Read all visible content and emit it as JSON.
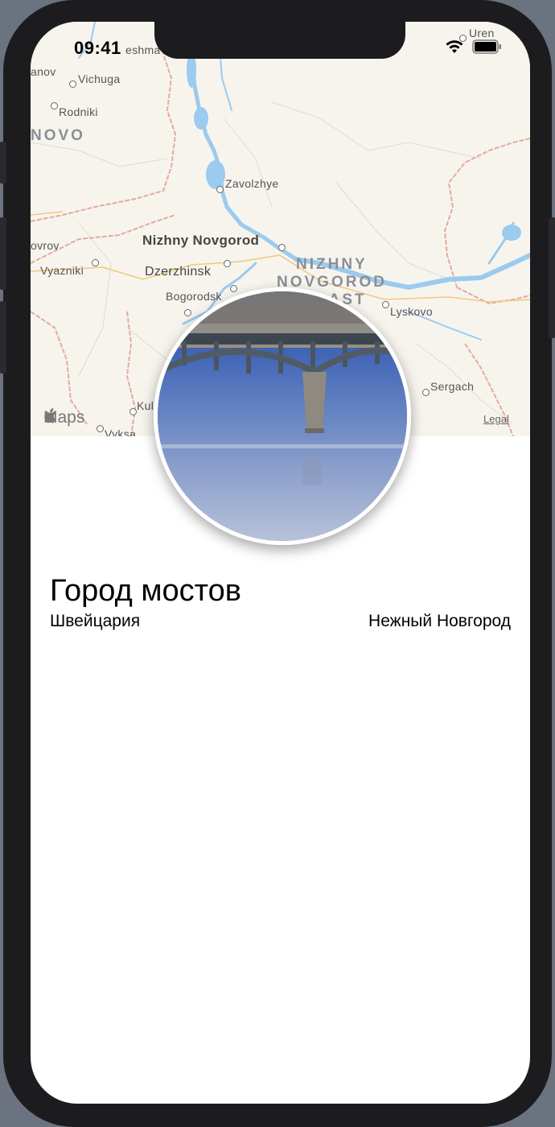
{
  "status_bar": {
    "time": "09:41"
  },
  "map": {
    "labels": {
      "uren": "Uren",
      "sheshma": "eshma",
      "ivanovo_partial": "anov",
      "vichuga": "Vichuga",
      "rodniki": "Rodniki",
      "ivanovo_region": "NOVO",
      "zavolzhye": "Zavolzhye",
      "nizhny": "Nizhny Novgorod",
      "kovrov": "ovrov",
      "vyazniki": "Vyazniki",
      "dzerzhinsk": "Dzerzhinsk",
      "region_line1": "NIZHNY",
      "region_line2": "NOVGOROD",
      "region_line3": "LAST",
      "bogorodsk": "Bogorodsk",
      "lyskovo": "Lyskovo",
      "sergach": "Sergach",
      "kulebaki": "Kul",
      "vyksa": "Vyksa"
    },
    "logo": "Maps",
    "legal": "Legal"
  },
  "place": {
    "title": "Город мостов",
    "country": "Швейцария",
    "city": "Нежный Новгород"
  }
}
